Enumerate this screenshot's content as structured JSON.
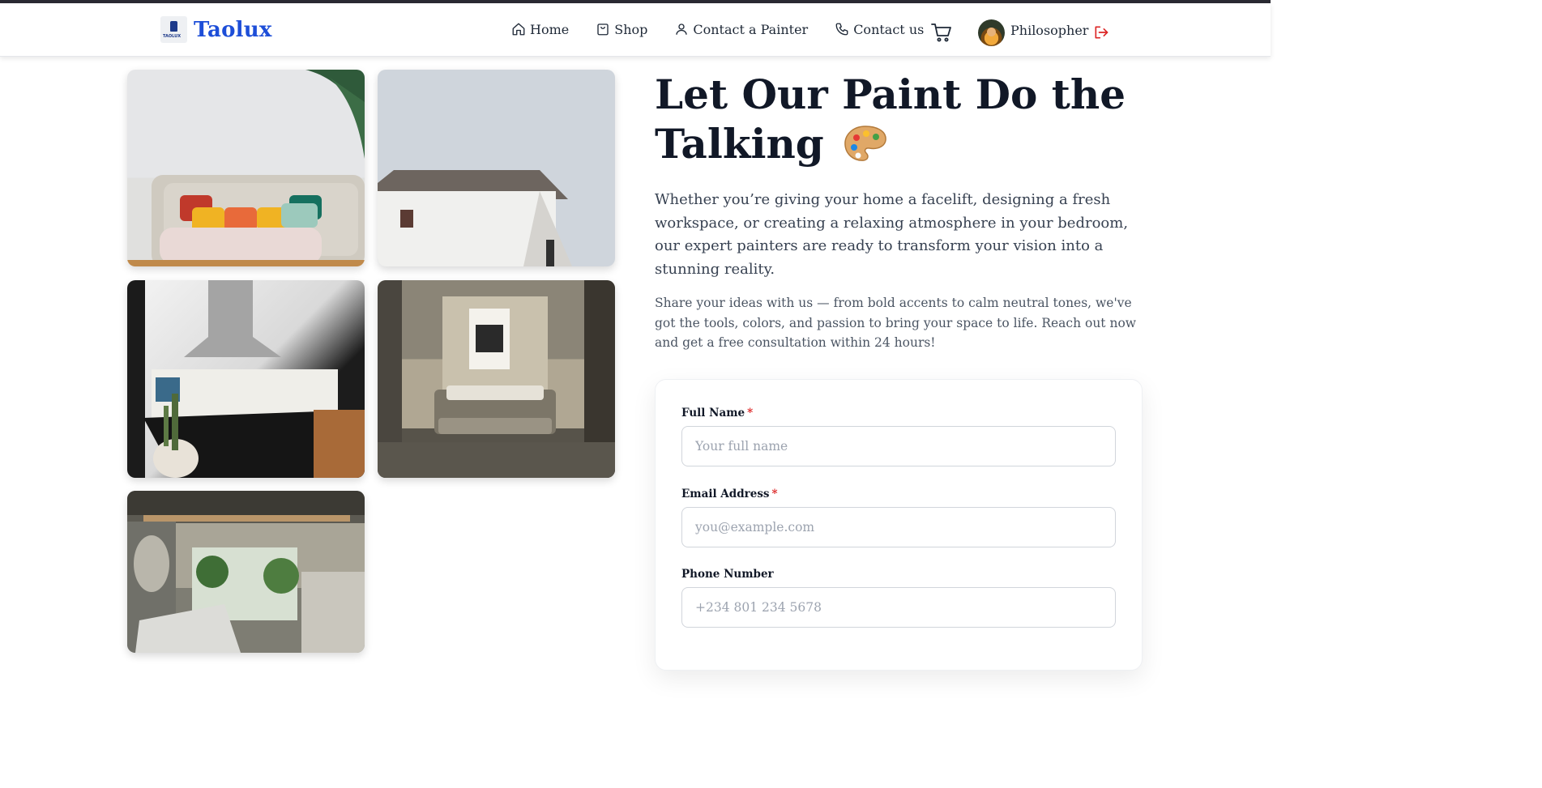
{
  "brand": {
    "name": "Taolux",
    "logo_text": "TAOLUX",
    "color": "#1d4ed8"
  },
  "nav": {
    "items": [
      {
        "label": "Home",
        "icon": "home-icon"
      },
      {
        "label": "Shop",
        "icon": "shopping-bag-icon"
      },
      {
        "label": "Contact a Painter",
        "icon": "user-icon"
      },
      {
        "label": "Contact us",
        "icon": "phone-icon"
      }
    ],
    "cart_icon": "cart-icon",
    "user": {
      "name": "Philosopher",
      "logout_icon": "logout-icon",
      "logout_color": "#dc2626"
    }
  },
  "gallery": {
    "images": [
      {
        "alt": "living room sofa with colorful pillows"
      },
      {
        "alt": "white house exterior"
      },
      {
        "alt": "modern kitchen"
      },
      {
        "alt": "bedroom interior"
      },
      {
        "alt": "bathroom interior"
      }
    ]
  },
  "hero": {
    "title": "Let Our Paint Do the Talking",
    "emoji": "🎨",
    "lead": "Whether you’re giving your home a facelift, designing a fresh workspace, or creating a relaxing atmosphere in your bedroom, our expert painters are ready to transform your vision into a stunning reality.",
    "sub": "Share your ideas with us — from bold accents to calm neutral tones, we've got the tools, colors, and passion to bring your space to life. Reach out now and get a free consultation within 24 hours!"
  },
  "form": {
    "full_name": {
      "label": "Full Name",
      "required_mark": "*",
      "placeholder": "Your full name",
      "value": ""
    },
    "email": {
      "label": "Email Address",
      "required_mark": "*",
      "placeholder": "you@example.com",
      "value": ""
    },
    "phone": {
      "label": "Phone Number",
      "placeholder": "+234 801 234 5678",
      "value": ""
    }
  }
}
